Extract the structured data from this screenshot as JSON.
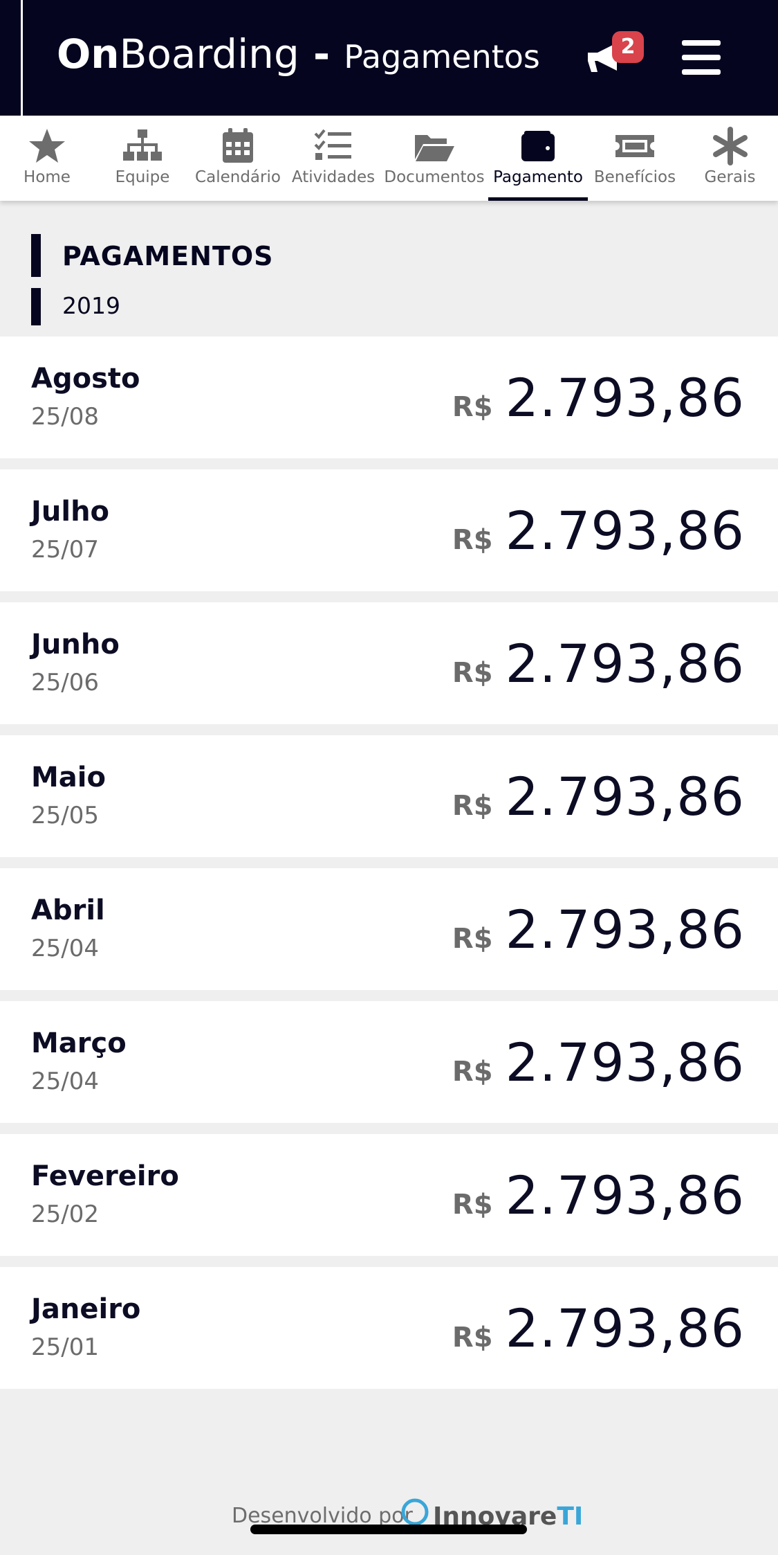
{
  "header": {
    "brand_bold": "On",
    "brand_rest": "Boarding",
    "separator": " - ",
    "section": "Pagamentos",
    "notification_count": "2"
  },
  "tabs": [
    {
      "label": "Home",
      "icon": "star-icon",
      "active": false
    },
    {
      "label": "Equipe",
      "icon": "org-chart-icon",
      "active": false
    },
    {
      "label": "Calendário",
      "icon": "calendar-icon",
      "active": false
    },
    {
      "label": "Atividades",
      "icon": "checklist-icon",
      "active": false
    },
    {
      "label": "Documentos",
      "icon": "folder-open-icon",
      "active": false
    },
    {
      "label": "Pagamento",
      "icon": "wallet-icon",
      "active": true
    },
    {
      "label": "Benefícios",
      "icon": "ticket-icon",
      "active": false
    },
    {
      "label": "Gerais",
      "icon": "asterisk-icon",
      "active": false
    }
  ],
  "section": {
    "title": "PAGAMENTOS",
    "year": "2019"
  },
  "payments": [
    {
      "month": "Agosto",
      "date": "25/08",
      "currency": "R$",
      "amount": "2.793,86"
    },
    {
      "month": "Julho",
      "date": "25/07",
      "currency": "R$",
      "amount": "2.793,86"
    },
    {
      "month": "Junho",
      "date": "25/06",
      "currency": "R$",
      "amount": "2.793,86"
    },
    {
      "month": "Maio",
      "date": "25/05",
      "currency": "R$",
      "amount": "2.793,86"
    },
    {
      "month": "Abril",
      "date": "25/04",
      "currency": "R$",
      "amount": "2.793,86"
    },
    {
      "month": "Março",
      "date": "25/04",
      "currency": "R$",
      "amount": "2.793,86"
    },
    {
      "month": "Fevereiro",
      "date": "25/02",
      "currency": "R$",
      "amount": "2.793,86"
    },
    {
      "month": "Janeiro",
      "date": "25/01",
      "currency": "R$",
      "amount": "2.793,86"
    }
  ],
  "footer": {
    "developed_by": "Desenvolvido por",
    "logo_main": "Innovare",
    "logo_accent": "TI"
  },
  "colors": {
    "header_bg": "#05051f",
    "badge": "#d9434b",
    "page_bg": "#efefef"
  }
}
